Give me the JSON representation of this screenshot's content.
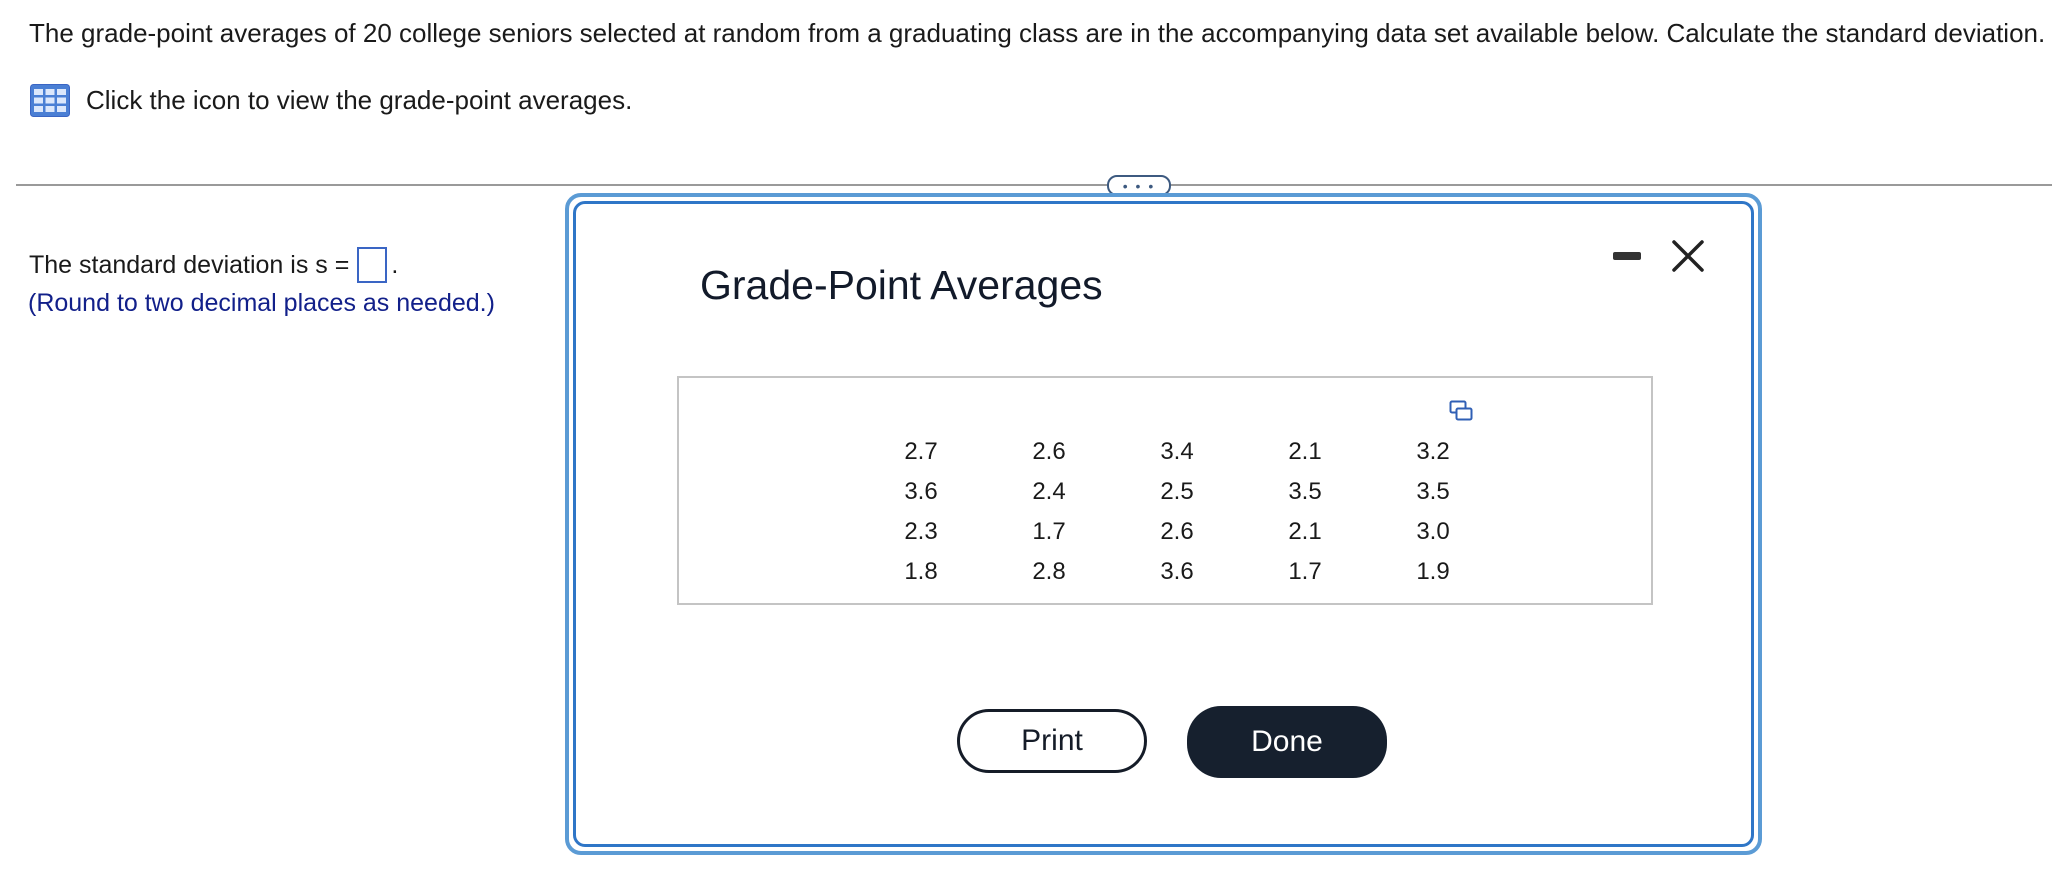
{
  "question": {
    "text": "The grade-point averages of 20 college seniors selected at random from a graduating class are in the accompanying data set available below. Calculate the standard deviation."
  },
  "hint": {
    "icon": "data-table-icon",
    "text": "Click the icon to view the grade-point averages."
  },
  "expander": {
    "label": "• • •"
  },
  "answer": {
    "prefix": "The standard deviation is s =",
    "suffix": ".",
    "value": "",
    "note": "(Round to two decimal places as needed.)"
  },
  "dialog": {
    "title": "Grade-Point Averages",
    "rows": [
      [
        "2.7",
        "2.6",
        "3.4",
        "2.1",
        "3.2"
      ],
      [
        "3.6",
        "2.4",
        "2.5",
        "3.5",
        "3.5"
      ],
      [
        "2.3",
        "1.7",
        "2.6",
        "2.1",
        "3.0"
      ],
      [
        "1.8",
        "2.8",
        "3.6",
        "1.7",
        "1.9"
      ]
    ],
    "print_label": "Print",
    "done_label": "Done"
  },
  "colors": {
    "accent": "#2f76c7",
    "dialog_border": "#5b9bd5",
    "note_text": "#12208a",
    "done_bg": "#16202e"
  }
}
